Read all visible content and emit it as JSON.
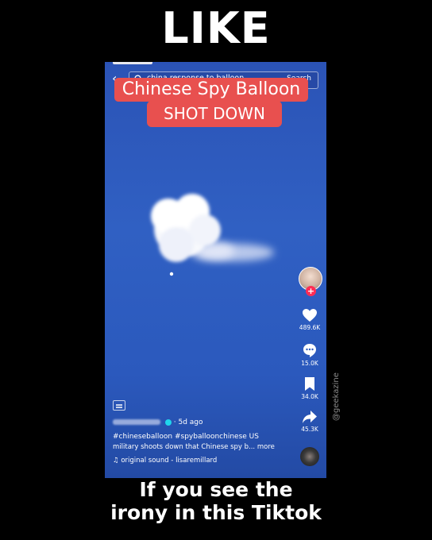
{
  "meme": {
    "top_caption": "LIKE",
    "bottom_caption_line1": "If you see the",
    "bottom_caption_line2": "irony in this Tiktok",
    "watermark": "@geekazine"
  },
  "app": {
    "search": {
      "query": "china response to balloon",
      "button_label": "Search"
    },
    "video_title": {
      "line1": "Chinese Spy Balloon",
      "line2": "SHOT DOWN"
    },
    "actions": {
      "likes": "489.6K",
      "comments": "15.0K",
      "saves": "34.0K",
      "shares": "45.3K"
    },
    "post": {
      "posted_ago": "· 5d ago",
      "hashtags": "#chineseballoon #spyballoonchinese US",
      "description": "military shoots down that Chinese spy b... more",
      "sound": "original sound - lisaremillard"
    },
    "colors": {
      "title_bg": "#e8504f",
      "video_bg": "#2e5bc0",
      "follow_badge": "#fe2c55"
    }
  }
}
